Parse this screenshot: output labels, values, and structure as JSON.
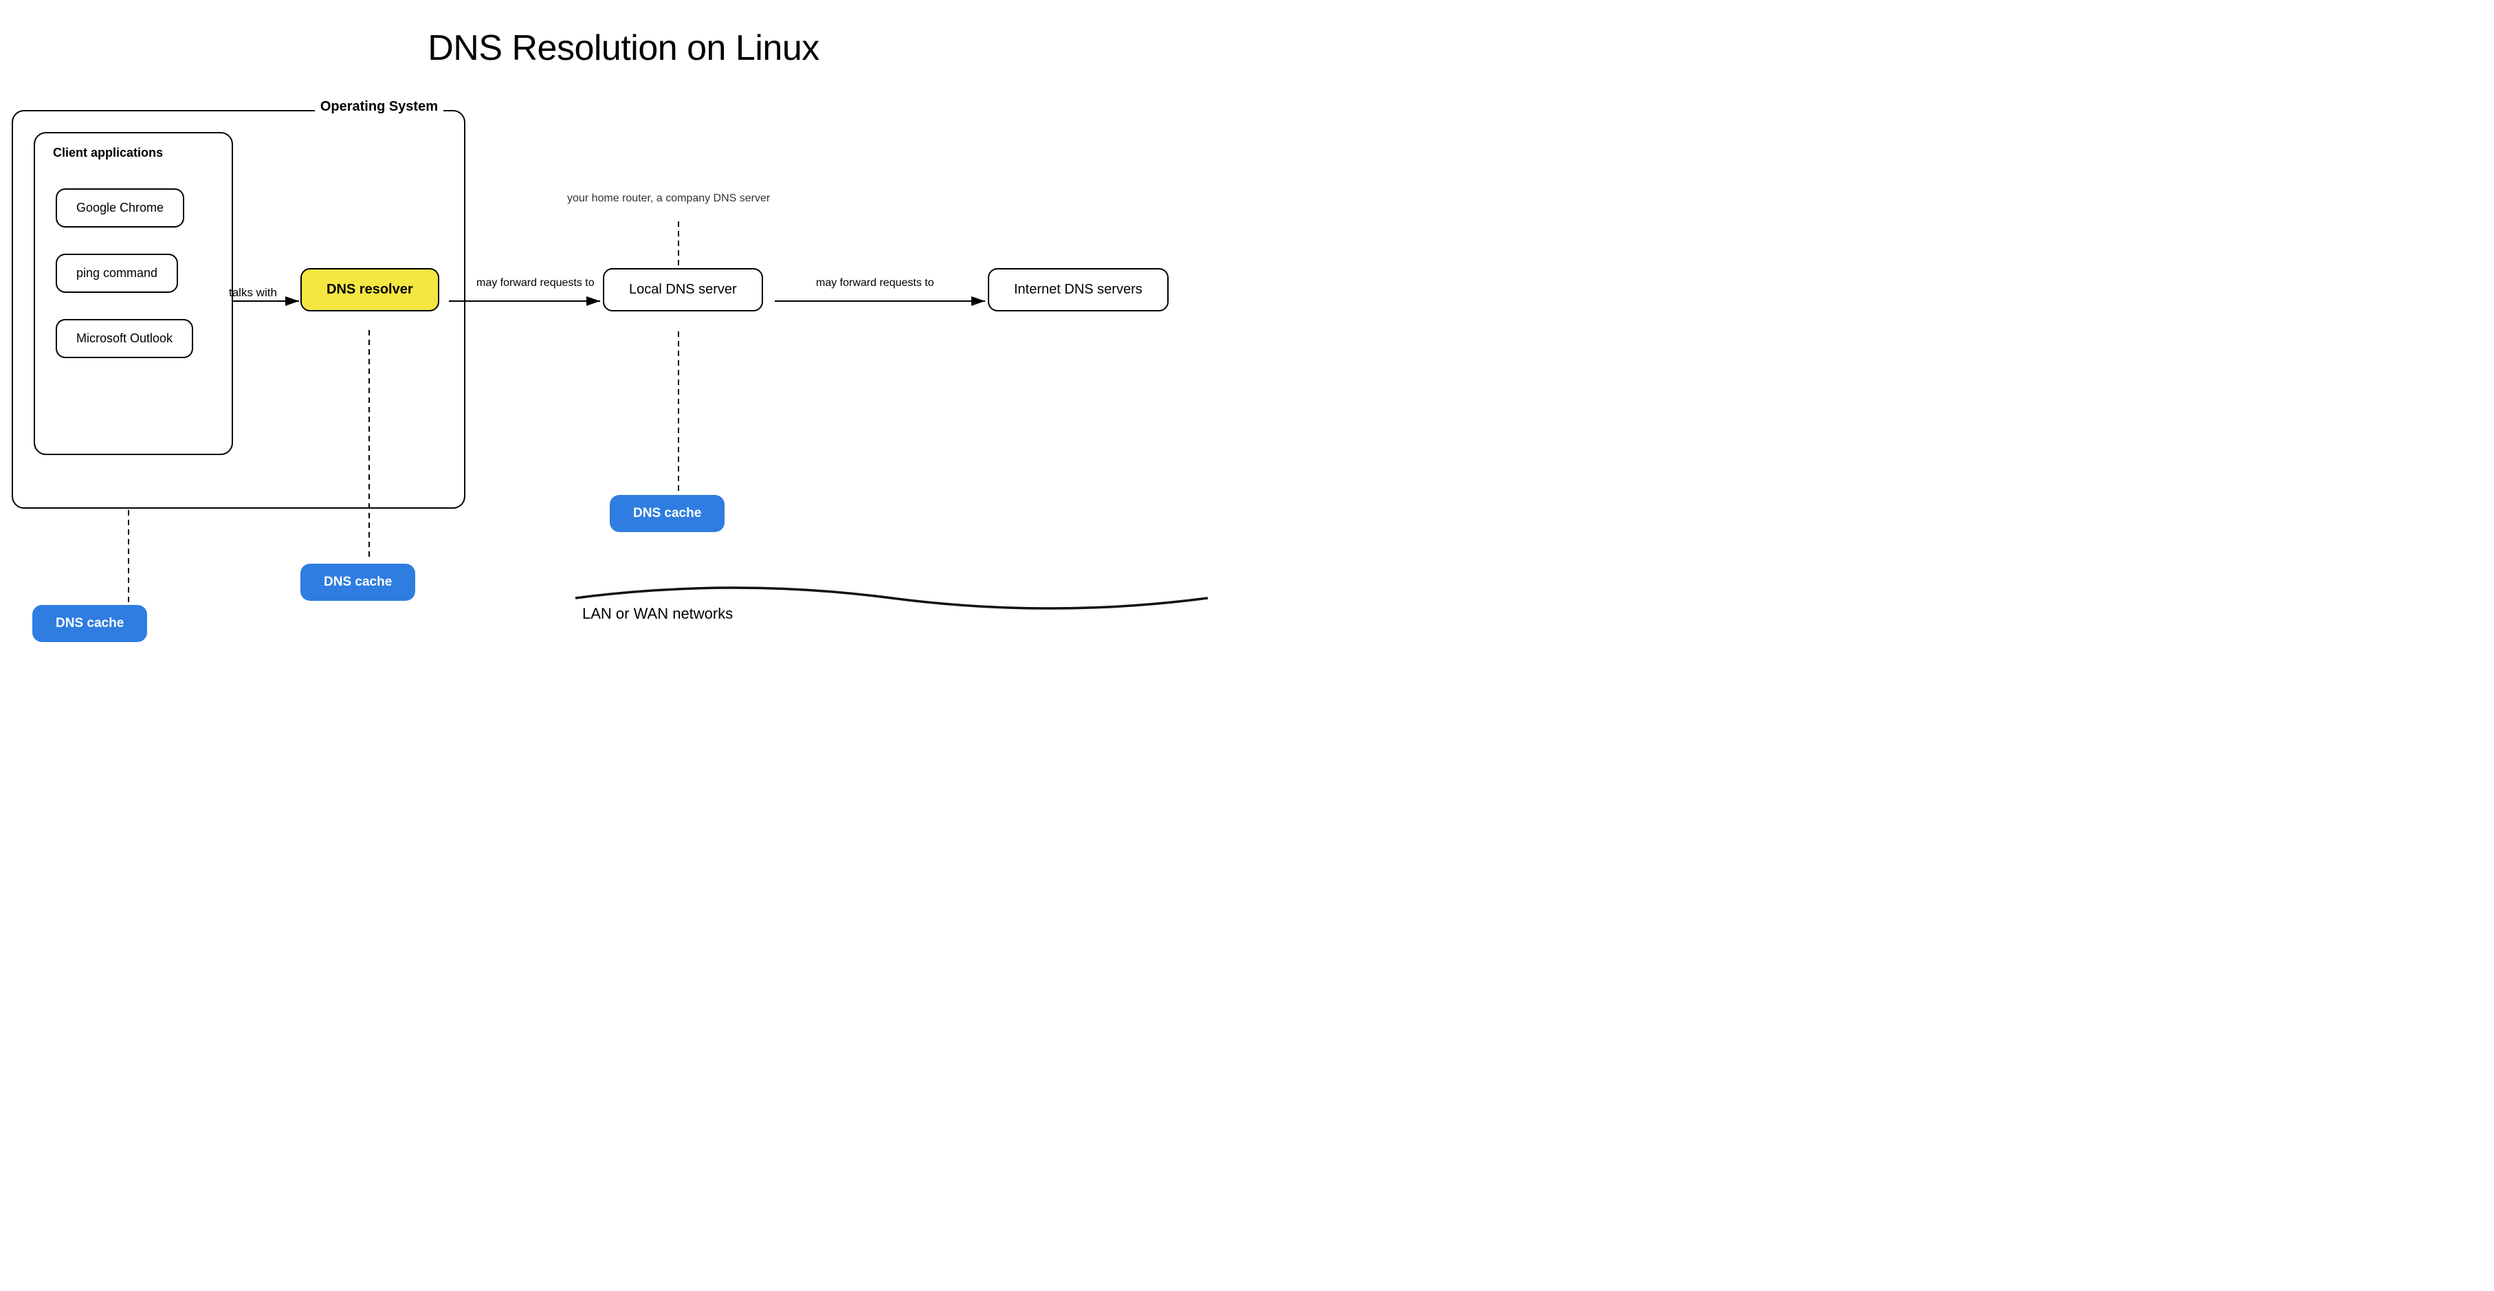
{
  "title": "DNS Resolution on Linux",
  "os_label": "Operating System",
  "client_apps_label": "Client applications",
  "apps": [
    "Google Chrome",
    "ping command",
    "Microsoft Outlook"
  ],
  "dns_resolver_label": "DNS resolver",
  "talks_with_label": "talks with",
  "local_dns_label": "Local DNS server",
  "internet_dns_label": "Internet DNS servers",
  "forward_label_1": "may forward requests to",
  "forward_label_2": "may forward requests to",
  "dns_cache_label": "DNS cache",
  "home_router_note": "your home router, a company DNS server",
  "lan_wan_label": "LAN or WAN networks"
}
